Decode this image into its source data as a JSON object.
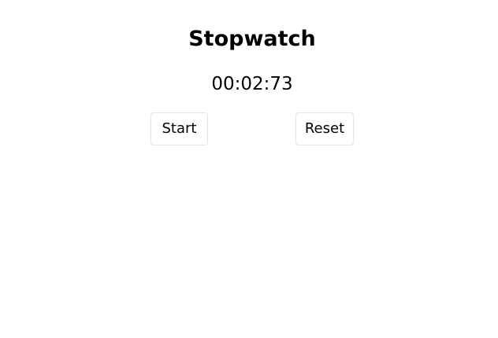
{
  "app": {
    "title": "Stopwatch"
  },
  "display": {
    "time": "00:02:73"
  },
  "controls": {
    "start_label": "Start",
    "reset_label": "Reset"
  }
}
